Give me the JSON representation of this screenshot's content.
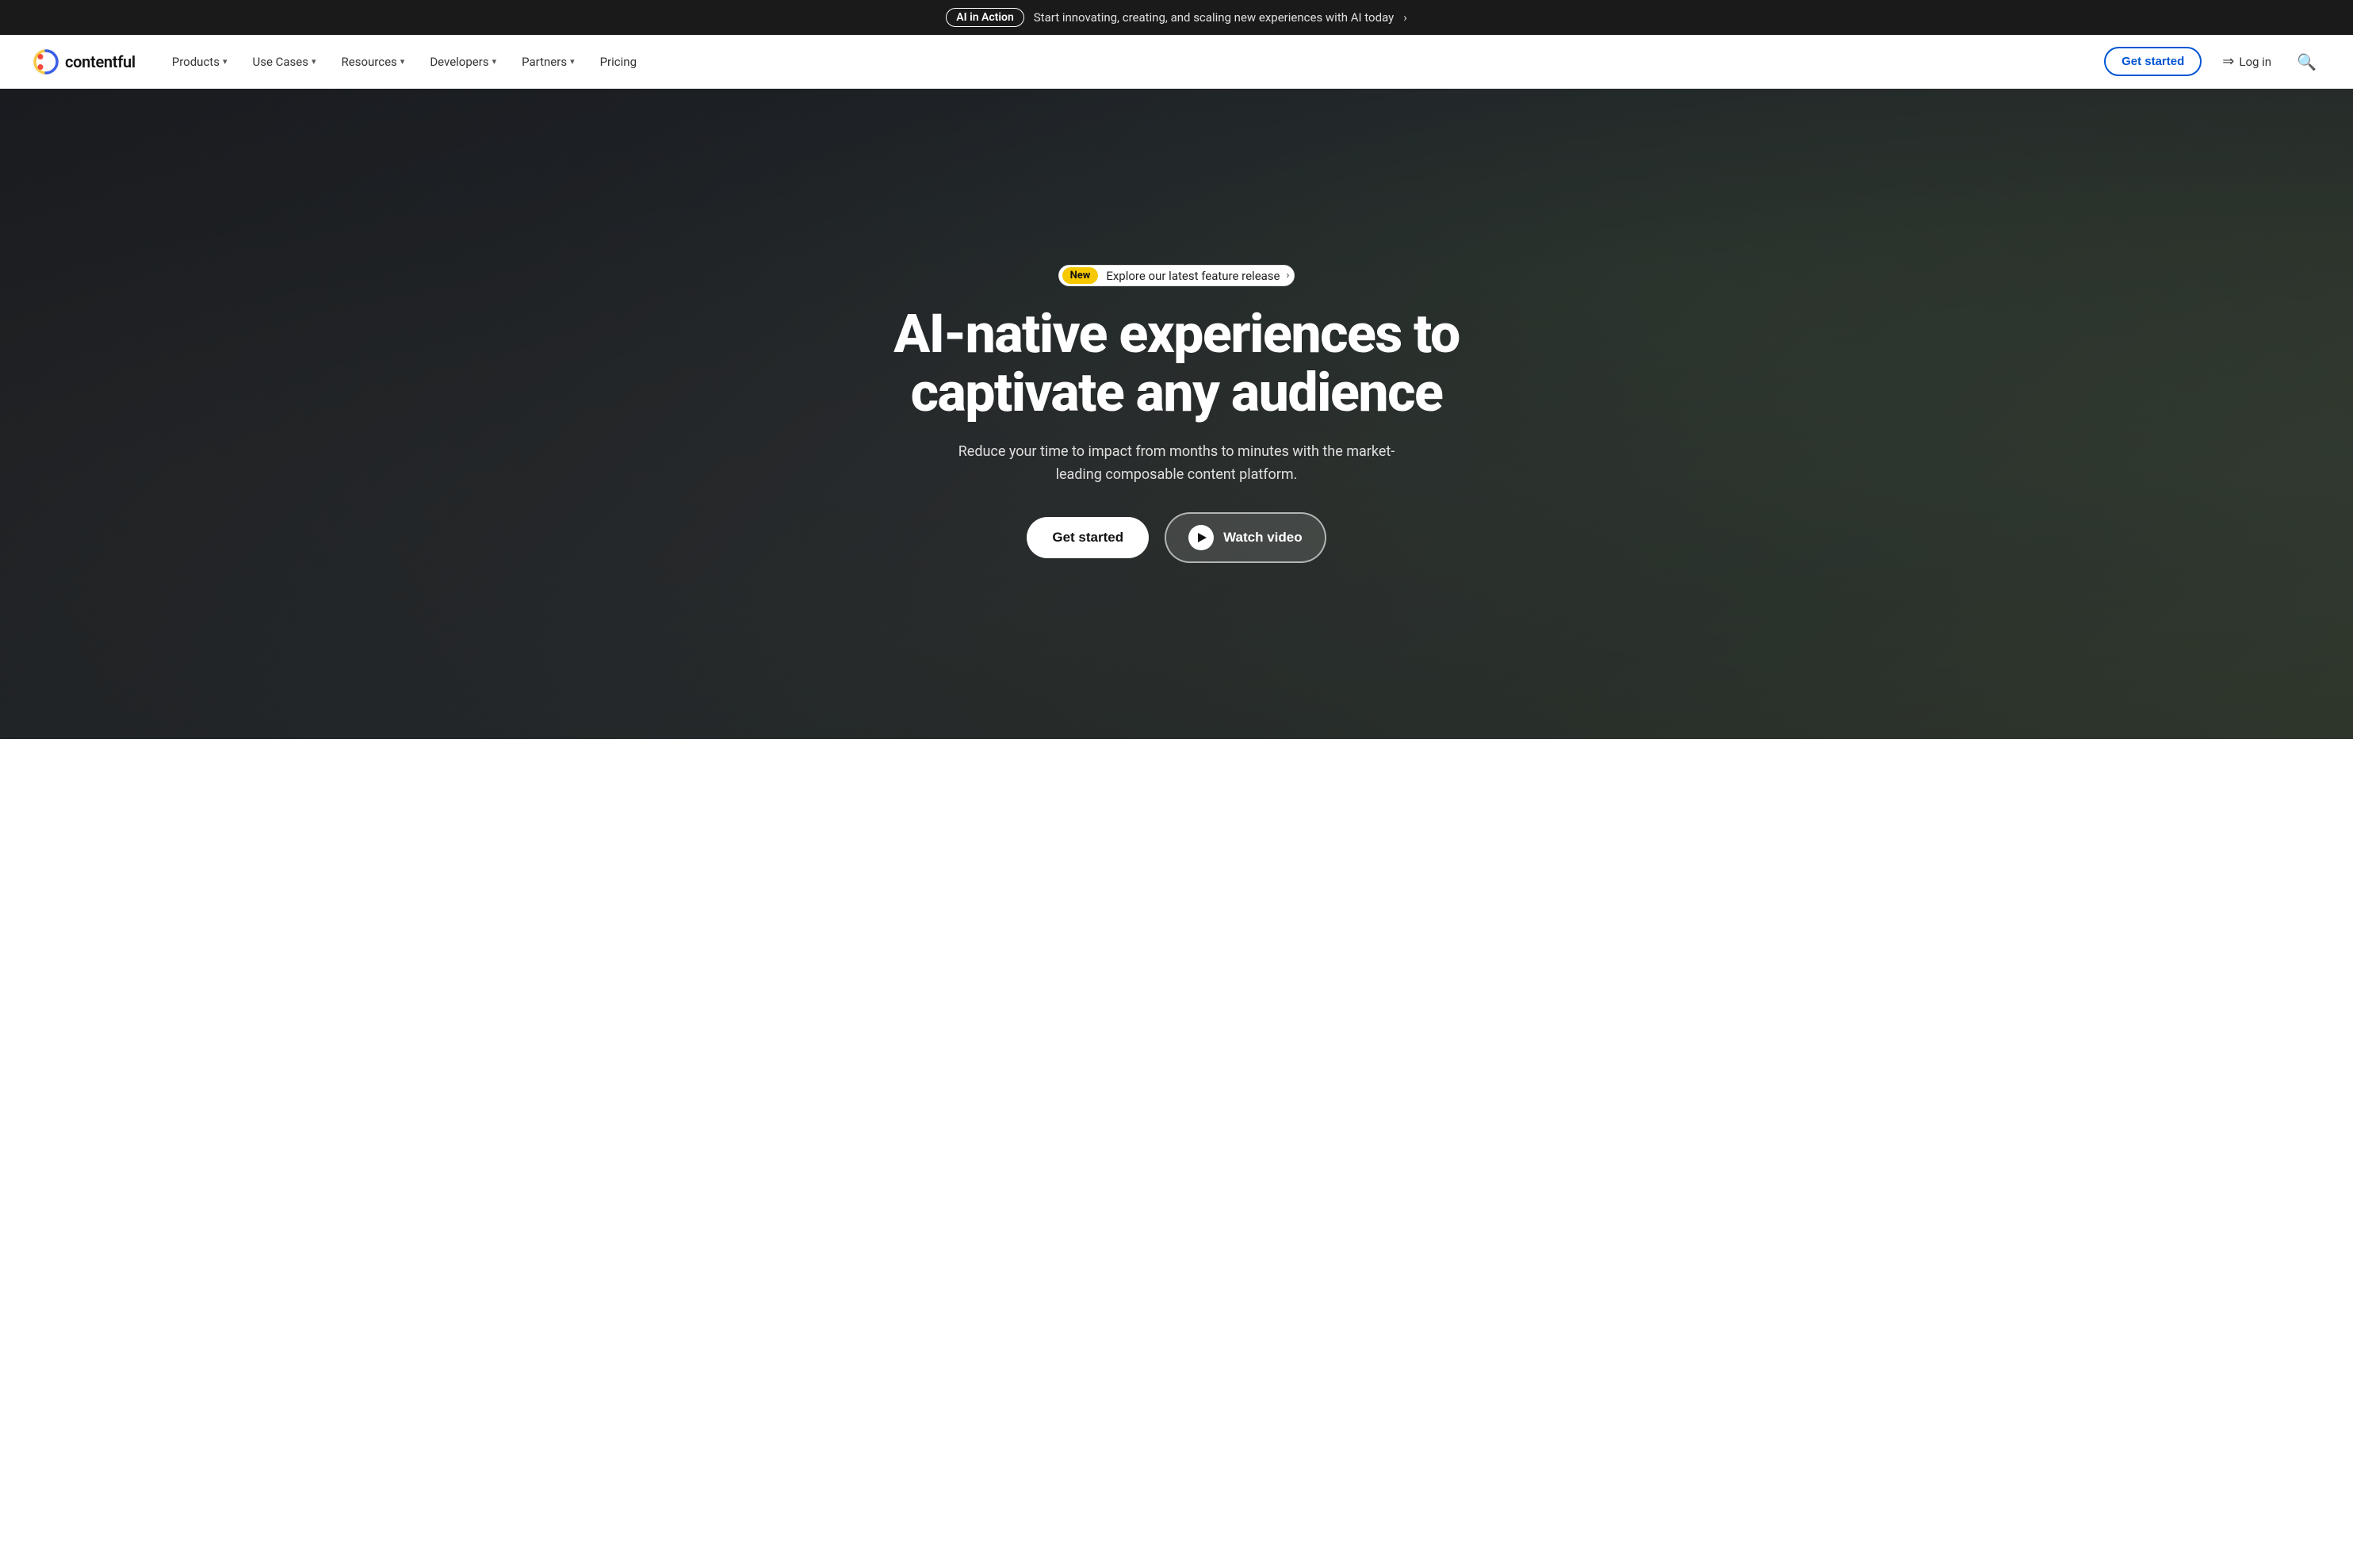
{
  "topBanner": {
    "badge": "AI in Action",
    "text": "Start innovating, creating, and scaling new experiences with AI today",
    "arrow": "›"
  },
  "navbar": {
    "logo": {
      "text": "contentful"
    },
    "items": [
      {
        "label": "Products",
        "hasChevron": true
      },
      {
        "label": "Use Cases",
        "hasChevron": true
      },
      {
        "label": "Resources",
        "hasChevron": true
      },
      {
        "label": "Developers",
        "hasChevron": true
      },
      {
        "label": "Partners",
        "hasChevron": true
      },
      {
        "label": "Pricing",
        "hasChevron": false
      }
    ],
    "cta": {
      "getStarted": "Get started",
      "login": "Log in"
    }
  },
  "hero": {
    "badge": {
      "newLabel": "New",
      "text": "Explore our latest feature release",
      "chevron": "›"
    },
    "title": "AI-native experiences to captivate any audience",
    "subtitle": "Reduce your time to impact from months to minutes with the market-leading composable content platform.",
    "ctaGetStarted": "Get started",
    "ctaWatchVideo": "Watch video"
  }
}
